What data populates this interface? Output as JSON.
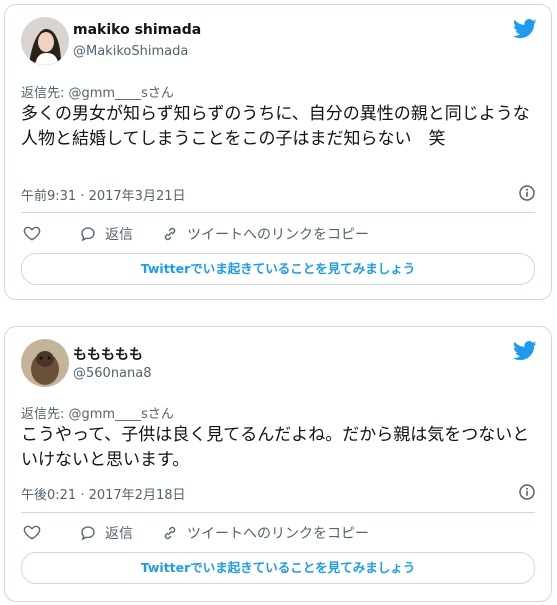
{
  "tweets": [
    {
      "display_name": "makiko shimada",
      "handle": "@MakikoShimada",
      "reply_to": "返信先: @gmm____sさん",
      "text": "多くの男女が知らず知らずのうちに、自分の異性の親と同じような人物と結婚してしまうことをこの子はまだ知らない　笑",
      "timestamp": "午前9:31 · 2017年3月21日",
      "actions": {
        "like": "",
        "reply": "返信",
        "copy_link": "ツイートへのリンクをコピー"
      },
      "cta": "Twitterでいま起きていることを見てみましょう"
    },
    {
      "display_name": "ももももも",
      "handle": "@560nana8",
      "reply_to": "返信先: @gmm____sさん",
      "text": "こうやって、子供は良く見てるんだよね。だから親は気をつないといけないと思います。",
      "timestamp": "午後0:21 · 2017年2月18日",
      "actions": {
        "like": "",
        "reply": "返信",
        "copy_link": "ツイートへのリンクをコピー"
      },
      "cta": "Twitterでいま起きていることを見てみましょう"
    }
  ],
  "colors": {
    "accent": "#1d9bf0",
    "muted": "#536471",
    "border": "#cfd9de"
  },
  "icons": [
    "twitter-bird-icon",
    "info-icon",
    "heart-icon",
    "reply-icon",
    "link-icon"
  ]
}
